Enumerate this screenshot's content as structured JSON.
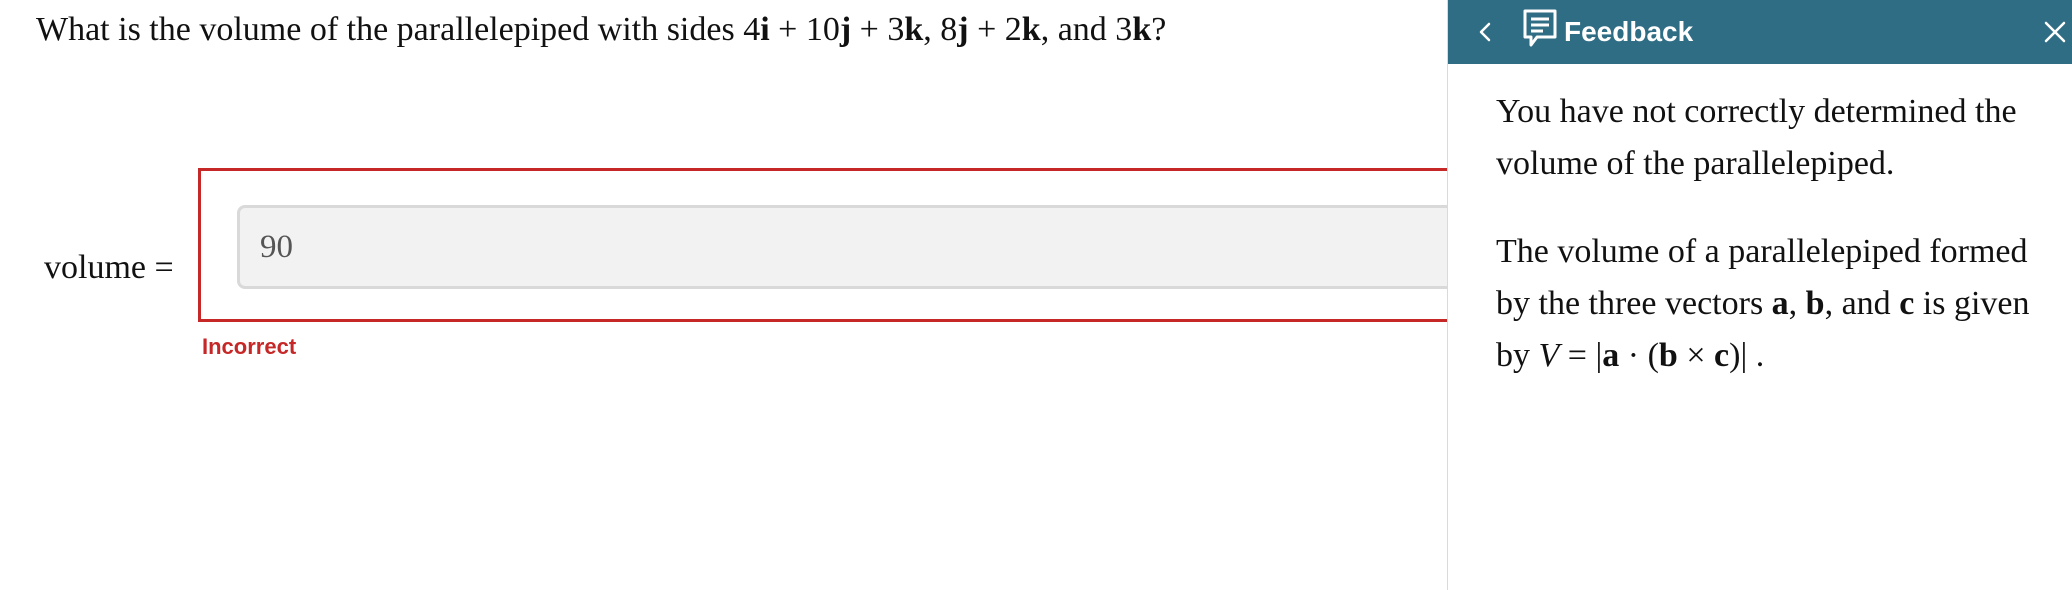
{
  "question": {
    "prefix": "What is the volume of the parallelepiped with sides 4",
    "v1_i": "i",
    "v1_mid1": " + 10",
    "v1_j": "j",
    "v1_mid2": " + 3",
    "v1_k": "k",
    "sep1": ", 8",
    "v2_j": "j",
    "v2_mid": " + 2",
    "v2_k": "k",
    "sep2": ", and 3",
    "v3_k": "k",
    "suffix": "?"
  },
  "answer": {
    "label": "volume =",
    "value": "90",
    "status": "Incorrect"
  },
  "feedback": {
    "title": "Feedback",
    "back_icon": "chevron-left-icon",
    "comment_icon": "comment-icon",
    "close_icon": "close-icon",
    "para1_line1": "You have not correctly determined the",
    "para1_line2": "volume of the parallelepiped.",
    "para2_line1": "The volume of a parallelepiped formed",
    "para2_line2_a": "by the three vectors ",
    "para2_line2_va": "a",
    "para2_line2_b": ", ",
    "para2_line2_vb": "b",
    "para2_line2_c": ", and ",
    "para2_line2_vc": "c",
    "para2_line2_d": " is given",
    "para2_line3_a": "by ",
    "para2_line3_V": "V",
    "para2_line3_b": " = |",
    "para2_line3_va": "a",
    "para2_line3_c": " · (",
    "para2_line3_vb": "b",
    "para2_line3_d": " × ",
    "para2_line3_vc": "c",
    "para2_line3_e": ")| ."
  },
  "colors": {
    "header_bg": "#2f6d85",
    "error": "#c62828",
    "input_bg": "#f2f2f2"
  }
}
